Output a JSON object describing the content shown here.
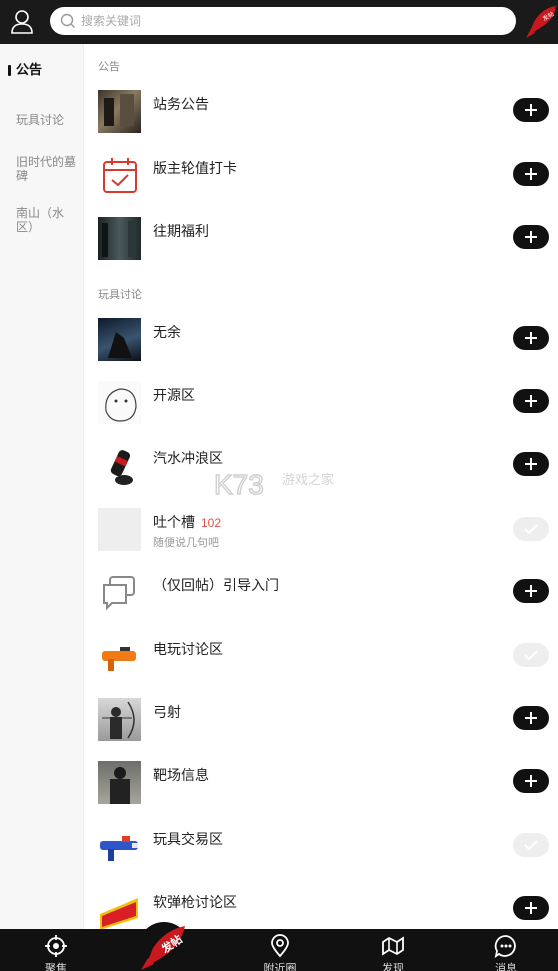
{
  "header": {
    "search_placeholder": "搜索关键词",
    "post_badge": "发帖"
  },
  "sidebar": {
    "items": [
      {
        "label": "公告"
      },
      {
        "label": "玩具讨论"
      },
      {
        "label": "旧时代的墓碑"
      },
      {
        "label": "南山（水区）"
      }
    ]
  },
  "sections": [
    {
      "title": "公告",
      "rows": [
        {
          "name": "站务公告",
          "action": "add"
        },
        {
          "name": "版主轮值打卡",
          "action": "add"
        },
        {
          "name": "往期福利",
          "action": "add"
        }
      ]
    },
    {
      "title": "玩具讨论",
      "rows": [
        {
          "name": "无余",
          "action": "add"
        },
        {
          "name": "开源区",
          "action": "add"
        },
        {
          "name": "汽水冲浪区",
          "action": "add"
        },
        {
          "name": "吐个槽",
          "count": "102",
          "desc": "随便说几句吧",
          "action": "done"
        },
        {
          "name": "（仅回帖）引导入门",
          "action": "add"
        },
        {
          "name": "电玩讨论区",
          "action": "done"
        },
        {
          "name": "弓射",
          "action": "add"
        },
        {
          "name": "靶场信息",
          "action": "add"
        },
        {
          "name": "玩具交易区",
          "action": "done"
        },
        {
          "name": "软弹枪讨论区",
          "action": "add"
        }
      ]
    }
  ],
  "bottom_nav": {
    "items": [
      {
        "label": "聚焦"
      },
      {
        "label": "发帖"
      },
      {
        "label": "附近圈"
      },
      {
        "label": "发现"
      },
      {
        "label": "消息"
      }
    ]
  },
  "watermark": {
    "brand": "K73",
    "text": "游戏之家"
  },
  "colors": {
    "header_bg": "#1a1a1a",
    "accent_red": "#e0504a",
    "rocket_red": "#c8191e",
    "add_button": "#111111",
    "done_button": "#eeeeee"
  },
  "icons": {
    "user": "user-icon",
    "search": "search-icon",
    "add": "plus-icon",
    "done": "check-icon",
    "rocket": "rocket-icon"
  }
}
